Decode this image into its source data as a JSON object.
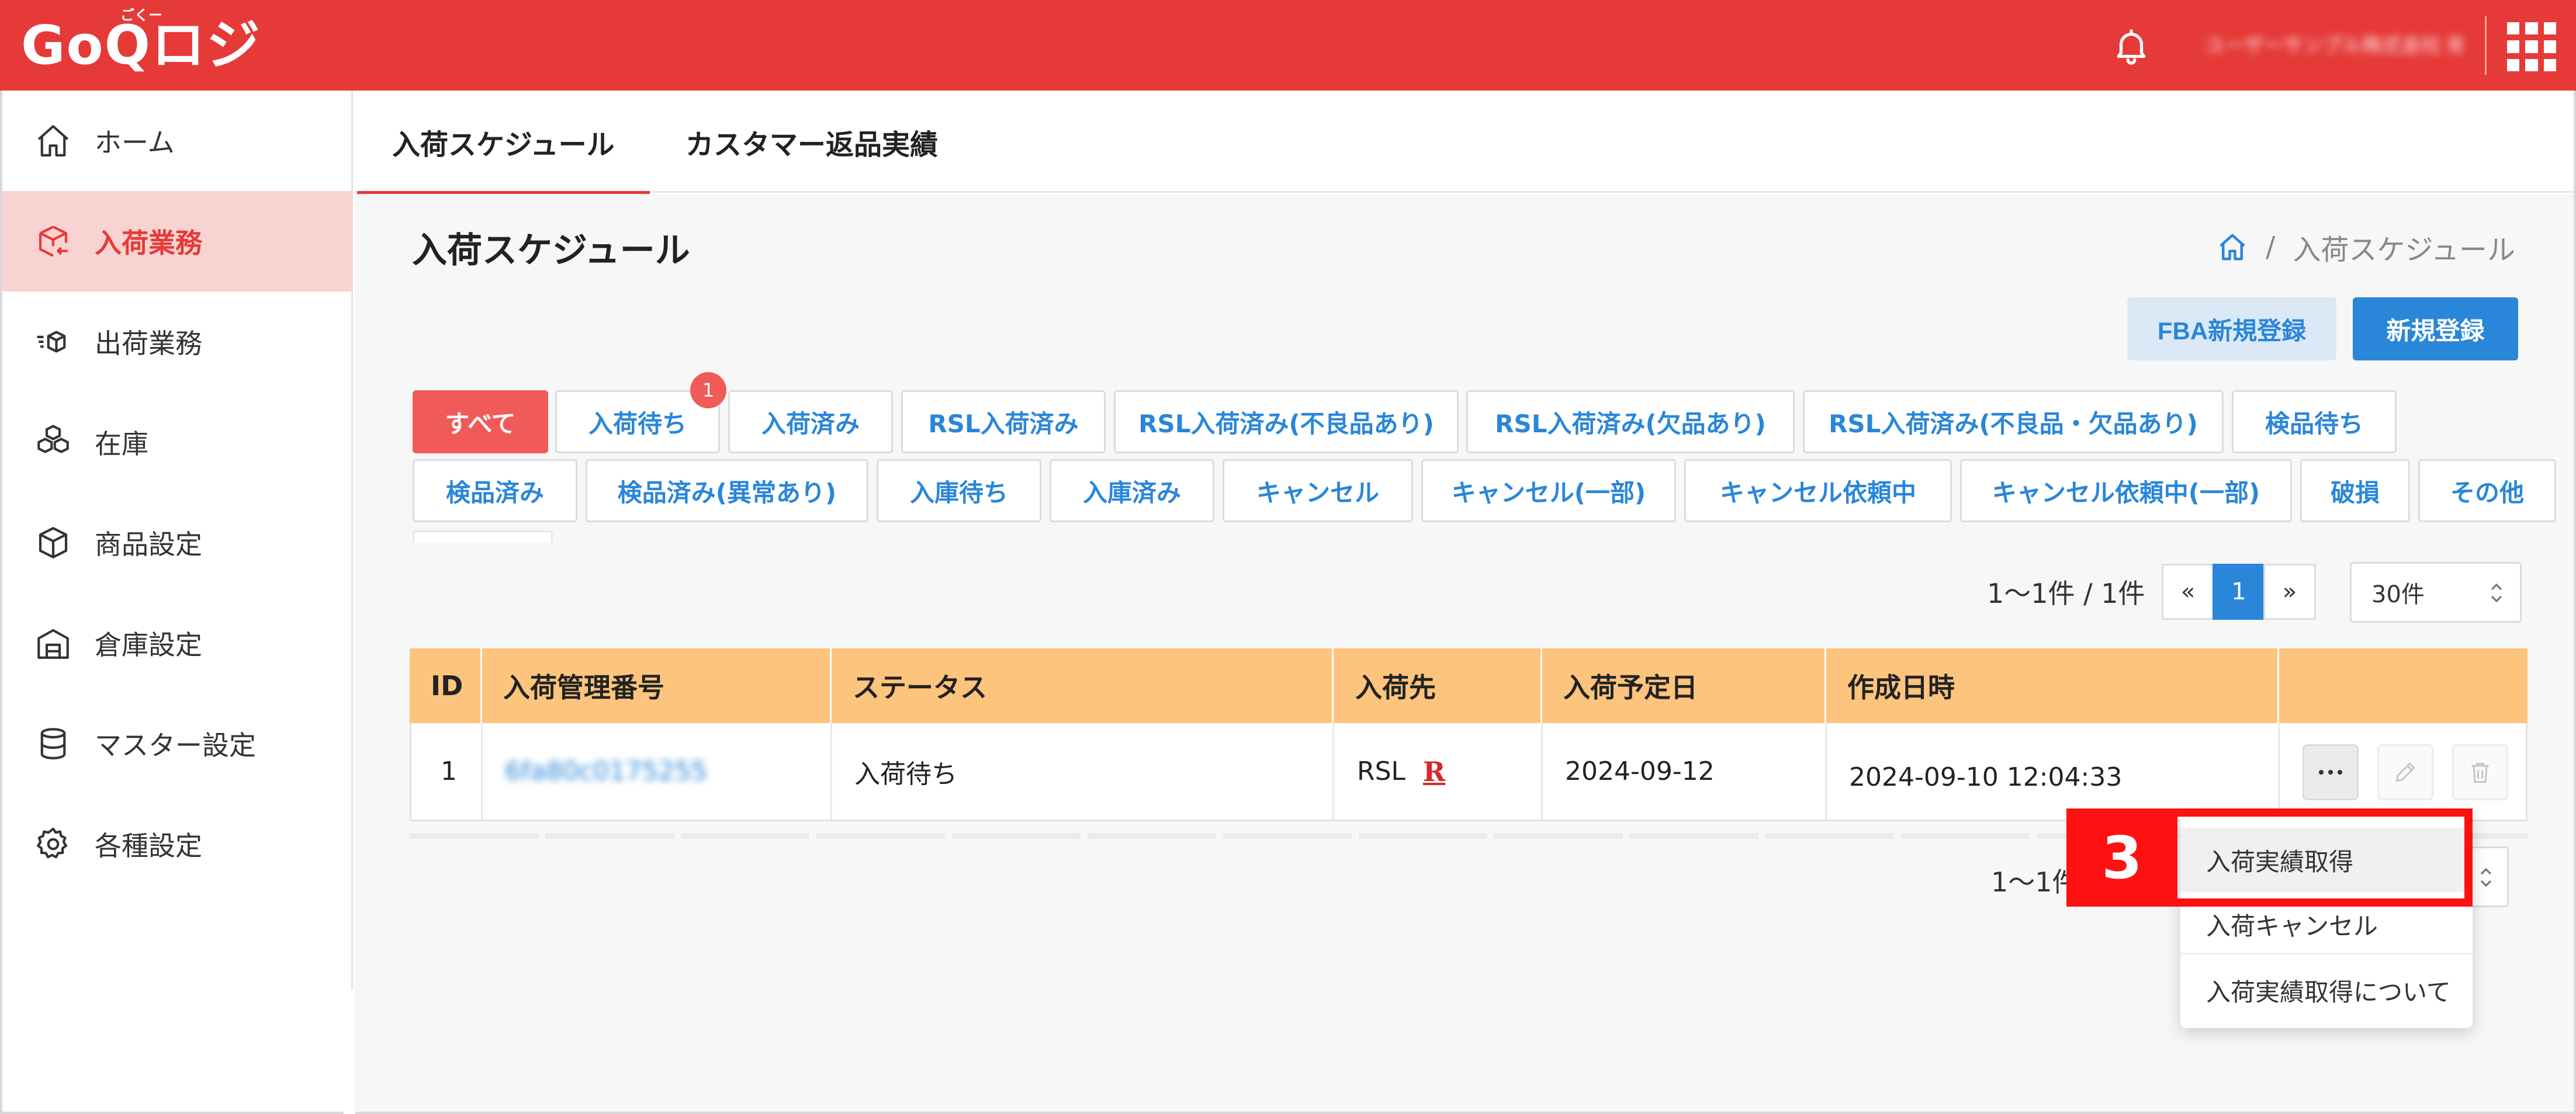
{
  "header": {
    "logo": "GoQロジ",
    "logo_ruby": "ごくー",
    "user_name": "ユーザーサンプル株式会社 様"
  },
  "sidebar": {
    "items": [
      {
        "label": "ホーム",
        "icon": "home-icon"
      },
      {
        "label": "入荷業務",
        "icon": "inbound-box-icon",
        "active": true
      },
      {
        "label": "出荷業務",
        "icon": "outbound-box-icon"
      },
      {
        "label": "在庫",
        "icon": "stock-boxes-icon"
      },
      {
        "label": "商品設定",
        "icon": "product-box-icon"
      },
      {
        "label": "倉庫設定",
        "icon": "warehouse-icon"
      },
      {
        "label": "マスター設定",
        "icon": "database-icon"
      },
      {
        "label": "各種設定",
        "icon": "gear-icon"
      }
    ]
  },
  "tabs": {
    "items": [
      "入荷スケジュール",
      "カスタマー返品実績"
    ]
  },
  "page": {
    "title": "入荷スケジュール",
    "breadcrumb_current": "入荷スケジュール",
    "breadcrumb_sep": "/"
  },
  "buttons": {
    "fba_new": "FBA新規登録",
    "new": "新規登録"
  },
  "filters": {
    "row1": [
      "すべて",
      "入荷待ち",
      "入荷済み",
      "RSL入荷済み",
      "RSL入荷済み(不良品あり)",
      "RSL入荷済み(欠品あり)",
      "RSL入荷済み(不良品・欠品あり)",
      "検品待ち"
    ],
    "row2": [
      "検品済み",
      "検品済み(異常あり)",
      "入庫待ち",
      "入庫済み",
      "キャンセル",
      "キャンセル(一部)",
      "キャンセル依頼中",
      "キャンセル依頼中(一部)",
      "破損",
      "その他"
    ],
    "badge": "1"
  },
  "pagination": {
    "count": "1〜1件 / 1件",
    "prev": "«",
    "current": "1",
    "next": "»",
    "per_page": "30件",
    "bottom_count": "1〜1件"
  },
  "table": {
    "headers": [
      "ID",
      "入荷管理番号",
      "ステータス",
      "入荷先",
      "入荷予定日",
      "作成日時"
    ],
    "rows": [
      {
        "id": "1",
        "number": "6fa80c0175255",
        "status": "入荷待ち",
        "destination": "RSL",
        "destination_mark": "R",
        "date": "2024-09-12",
        "created": "2024-09-10 12:04:33"
      }
    ]
  },
  "dropdown": {
    "items": [
      "入荷実績取得",
      "入荷キャンセル",
      "入荷実績取得について"
    ]
  },
  "callout": {
    "number": "3"
  },
  "colors": {
    "brand": "#e53a38",
    "accent_blue": "#2a86d8",
    "table_header": "#fcc47c",
    "callout_red": "#ff1111"
  }
}
